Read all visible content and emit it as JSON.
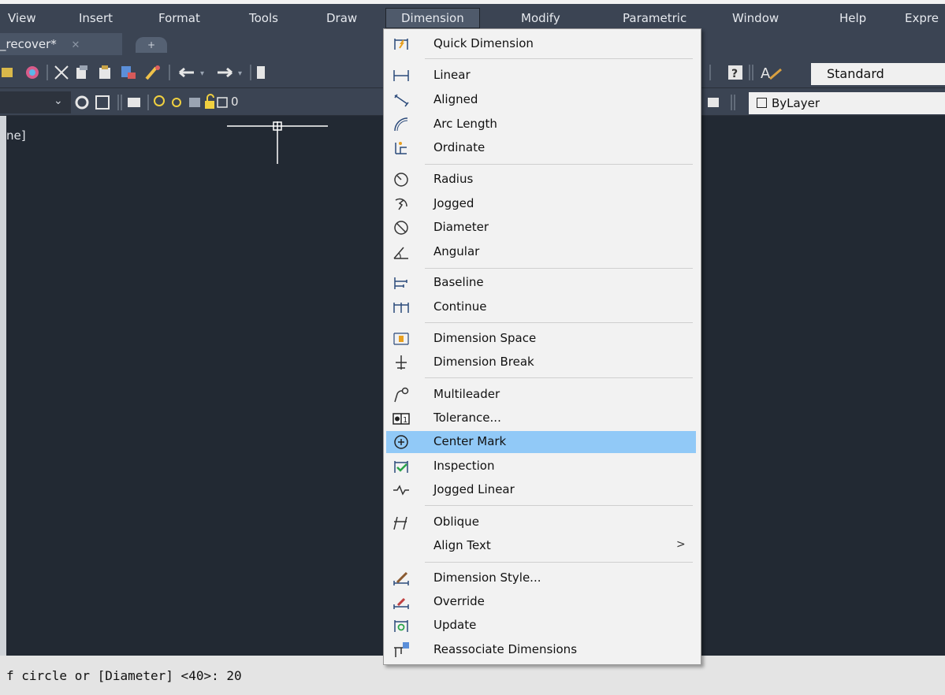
{
  "menubar": {
    "items": [
      "View",
      "Insert",
      "Format",
      "Tools",
      "Draw",
      "Dimension",
      "Modify",
      "Parametric",
      "Window",
      "Help",
      "Expre"
    ],
    "active": "Dimension"
  },
  "tabs": {
    "doc_label": "_recover*",
    "close_glyph": "✕",
    "new_glyph": "+"
  },
  "toolbar": {
    "text_style": "Standard",
    "layer_value": "0",
    "color_value": "ByLayer"
  },
  "drawing": {
    "viewport_label": "ne]"
  },
  "command_line": {
    "text": "f circle or [Diameter] <40>: 20"
  },
  "dimension_menu": {
    "items": [
      {
        "label": "Quick Dimension",
        "icon": "quick-dimension-icon"
      },
      {
        "label": "Linear",
        "icon": "linear-dimension-icon"
      },
      {
        "label": "Aligned",
        "icon": "aligned-dimension-icon"
      },
      {
        "label": "Arc Length",
        "icon": "arc-length-icon"
      },
      {
        "label": "Ordinate",
        "icon": "ordinate-icon"
      },
      {
        "label": "Radius",
        "icon": "radius-icon"
      },
      {
        "label": "Jogged",
        "icon": "jogged-icon"
      },
      {
        "label": "Diameter",
        "icon": "diameter-icon"
      },
      {
        "label": "Angular",
        "icon": "angular-icon"
      },
      {
        "label": "Baseline",
        "icon": "baseline-icon"
      },
      {
        "label": "Continue",
        "icon": "continue-icon"
      },
      {
        "label": "Dimension Space",
        "icon": "dimension-space-icon"
      },
      {
        "label": "Dimension Break",
        "icon": "dimension-break-icon"
      },
      {
        "label": "Multileader",
        "icon": "multileader-icon"
      },
      {
        "label": "Tolerance...",
        "icon": "tolerance-icon"
      },
      {
        "label": "Center Mark",
        "icon": "center-mark-icon",
        "highlighted": true
      },
      {
        "label": "Inspection",
        "icon": "inspection-icon"
      },
      {
        "label": "Jogged Linear",
        "icon": "jogged-linear-icon"
      },
      {
        "label": "Oblique",
        "icon": "oblique-icon"
      },
      {
        "label": "Align Text",
        "icon": "",
        "submenu": true,
        "arrow": ">"
      },
      {
        "label": "Dimension Style...",
        "icon": "dimension-style-icon"
      },
      {
        "label": "Override",
        "icon": "override-icon"
      },
      {
        "label": "Update",
        "icon": "update-icon"
      },
      {
        "label": "Reassociate Dimensions",
        "icon": "reassociate-icon"
      }
    ]
  },
  "colors": {
    "menubar_bg": "#3b4453",
    "drawing_bg": "#222933",
    "menu_bg": "#f2f2f2",
    "highlight": "#91c9f7"
  }
}
